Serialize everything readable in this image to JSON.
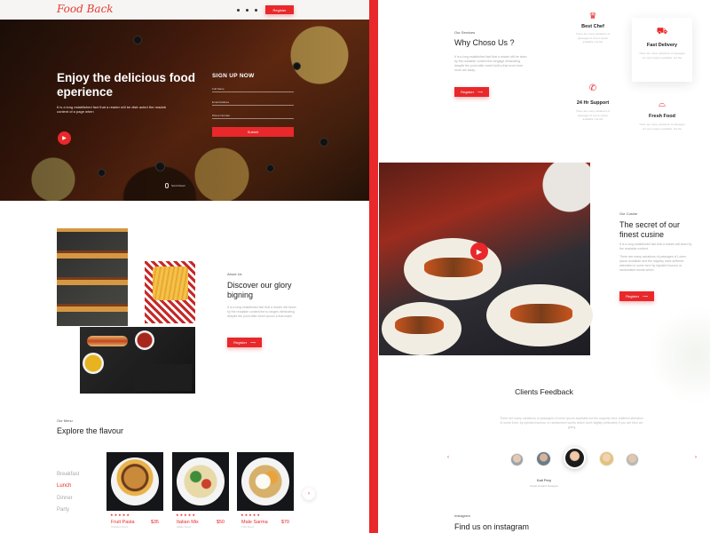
{
  "brand": {
    "logo": "Food Back",
    "accent": "#e8282b"
  },
  "nav": {
    "register_label": "Register"
  },
  "hero": {
    "title": "Enjoy the delicious food eperience",
    "text": "It is a long established fact that a reader will be distr acted the readab content of a page when",
    "signup_title": "SIGN UP NOW",
    "fields": [
      "Full Name",
      "Email Address",
      "Phone Number"
    ],
    "submit_label": "Submit",
    "scroll_label": "Scroll Down"
  },
  "about": {
    "subtitle": "About Us",
    "title": "Discover our glory bigning",
    "text": "It is a long established fact that a reader will beam by the readable content the to ranges eliminating despite the point after lorem ipsum a that make",
    "register_label": "Register"
  },
  "menu": {
    "subtitle": "Our Menu",
    "title": "Explore the flavour",
    "categories": [
      "Breakfast",
      "Lunch",
      "Dinner",
      "Party"
    ],
    "active_category": "Lunch",
    "items": [
      {
        "name": "Fruit Pasta",
        "price": "$35",
        "desc": "Chicken Food",
        "stars": "★★★★★"
      },
      {
        "name": "Italian Mix",
        "price": "$50",
        "desc": "Italian Food",
        "stars": "★★★★★"
      },
      {
        "name": "Male Sarma",
        "price": "$70",
        "desc": "Turk Food",
        "stars": "★★★★★"
      }
    ]
  },
  "services": {
    "subtitle": "Our Services",
    "title": "Why Choso Us ?",
    "text": "It is a long established fact that a reader will be team by the readable content the rangage eliminating despite the point after event built a that more from room am away.",
    "register_label": "Register",
    "cards": [
      {
        "icon": "chef-hat-icon",
        "name": "Best Chef",
        "desc": "There are many variations of passages of Lorem ipsum available, but the"
      },
      {
        "icon": "delivery-scooter-icon",
        "name": "Fast Delivery",
        "desc": "There are many variations of passages of Lorem ipsum available, but the"
      },
      {
        "icon": "24hr-support-icon",
        "name": "24 Hr Support",
        "desc": "There are many variations of passages of Lorem ipsum available, but the"
      },
      {
        "icon": "cloche-icon",
        "name": "Fresh Food",
        "desc": "There are many variations of passages of Lorem ipsum available, but the"
      }
    ]
  },
  "cuisine": {
    "subtitle": "Our Cusine",
    "title": "The secret of our finest cusine",
    "text1": "It is a long established fact that a reader will team by the readable content.",
    "text2": "There are many variations of passages of Lorem ipsum available and the majority have suffered alteration in some form by injected humour or randomised words which",
    "register_label": "Register"
  },
  "feedback": {
    "title": "Clients Feedback",
    "text": "There are many variations of passages of lorem ipsum available but the majority have suffered alteration in some form, by injected humour or randomised words which don't slightly believable if you are then we going",
    "reviewer_name": "Kati Pery",
    "reviewer_role": "Visual Graphic Designer"
  },
  "instagram": {
    "subtitle": "Instagram",
    "title": "Find us on instagram"
  }
}
